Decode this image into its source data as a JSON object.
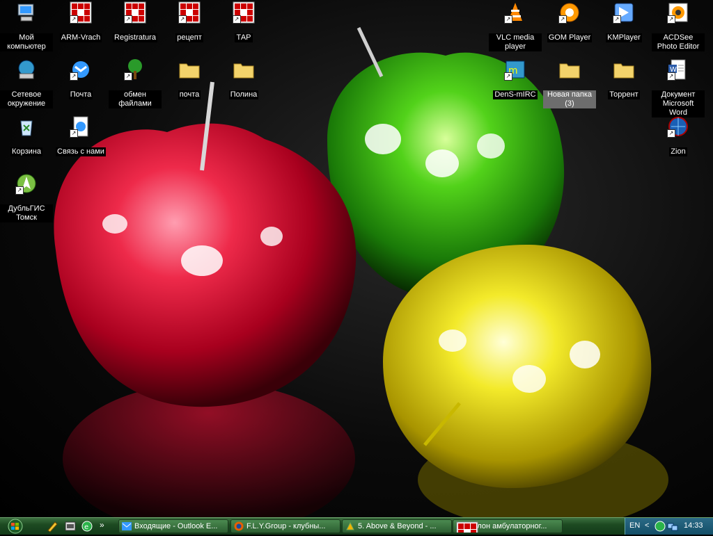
{
  "desktop": {
    "icons": [
      {
        "label": "Мой компьютер",
        "icon": "computer-icon"
      },
      {
        "label": "ARM-Vrach",
        "icon": "grid-app-icon"
      },
      {
        "label": "Registratura",
        "icon": "grid-app-icon"
      },
      {
        "label": "рецепт",
        "icon": "grid-app-icon"
      },
      {
        "label": "ТАР",
        "icon": "grid-app-icon"
      },
      {
        "label": "VLC media player",
        "icon": "vlc-cone-icon"
      },
      {
        "label": "GOM Player",
        "icon": "gom-player-icon"
      },
      {
        "label": "KMPlayer",
        "icon": "kmplayer-icon"
      },
      {
        "label": "ACDSee Photo Editor",
        "icon": "acdsee-icon"
      },
      {
        "label": "Сетевое окружение",
        "icon": "network-icon"
      },
      {
        "label": "Почта",
        "icon": "mail-icon"
      },
      {
        "label": "обмен файлами",
        "icon": "tree-icon"
      },
      {
        "label": "почта",
        "icon": "folder-icon"
      },
      {
        "label": "Полина",
        "icon": "folder-icon"
      },
      {
        "label": "DenS-mIRC",
        "icon": "mirc-icon"
      },
      {
        "label": "Новая папка (3)",
        "icon": "folder-icon"
      },
      {
        "label": "Торрент",
        "icon": "folder-icon"
      },
      {
        "label": "Документ Microsoft Word",
        "icon": "word-document-icon"
      },
      {
        "label": "Корзина",
        "icon": "recycle-bin-icon"
      },
      {
        "label": "Связь с нами",
        "icon": "contact-icon"
      },
      {
        "label": "Zion",
        "icon": "zion-globe-icon"
      },
      {
        "label": "ДубльГИС Томск",
        "icon": "dublgis-icon"
      }
    ]
  },
  "taskbar": {
    "tasks": [
      {
        "label": "Входящие - Outlook E...",
        "icon": "outlook-icon"
      },
      {
        "label": "F.L.Y.Group - клубны...",
        "icon": "firefox-icon"
      },
      {
        "label": "5. Above & Beyond - ...",
        "icon": "winamp-icon"
      },
      {
        "label": "Талон амбулаторног...",
        "icon": "grid-app-icon"
      }
    ],
    "chevron": "»",
    "language": "EN",
    "tray_arrow": "<",
    "clock": "14:33"
  }
}
